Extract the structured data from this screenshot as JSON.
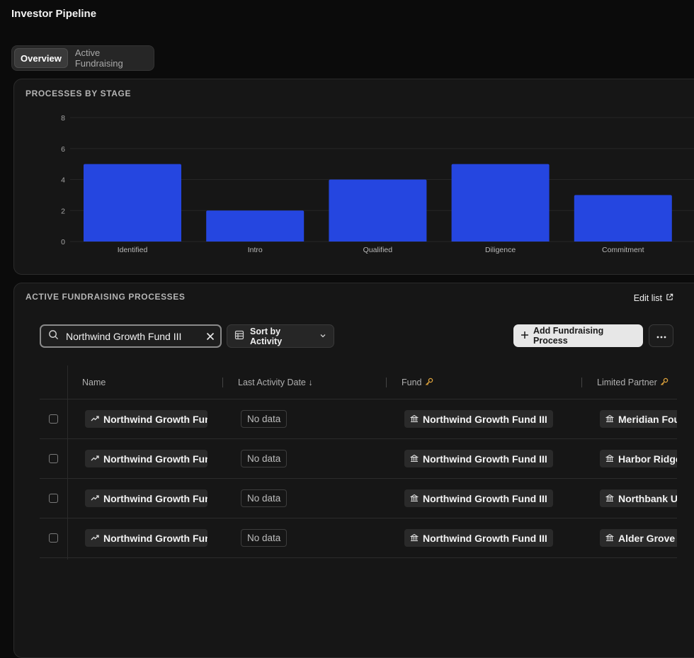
{
  "page": {
    "title": "Investor Pipeline"
  },
  "tabs": [
    {
      "label": "Overview",
      "active": true
    },
    {
      "label": "Active Fundraising",
      "active": false
    }
  ],
  "chart_section": {
    "title": "PROCESSES BY STAGE"
  },
  "chart_data": {
    "type": "bar",
    "title": "",
    "xlabel": "",
    "ylabel": "",
    "categories": [
      "Identified",
      "Intro",
      "Qualified",
      "Diligence",
      "Commitment"
    ],
    "values": [
      5,
      2,
      4,
      5,
      3
    ],
    "ylim": [
      0,
      8
    ],
    "yticks": [
      0,
      2,
      4,
      6,
      8
    ],
    "grid": true,
    "bar_color": "#2546e0"
  },
  "table_section": {
    "title": "ACTIVE FUNDRAISING PROCESSES",
    "edit_list_label": "Edit list",
    "search": {
      "value": "Northwind Growth Fund III",
      "icon": "search-icon"
    },
    "sort_label": "Sort by Activity",
    "add_label": "Add Fundraising Process",
    "columns": [
      {
        "label": "Name"
      },
      {
        "label": "Last Activity Date ↓"
      },
      {
        "label": "Fund"
      },
      {
        "label": "Limited Partner"
      }
    ],
    "rows": [
      {
        "name": "Northwind Growth Fund III",
        "last_activity": "No data",
        "fund": "Northwind Growth Fund III",
        "limited_partner": "Meridian Foundation"
      },
      {
        "name": "Northwind Growth Fund III",
        "last_activity": "No data",
        "fund": "Northwind Growth Fund III",
        "limited_partner": "Harbor Ridge"
      },
      {
        "name": "Northwind Growth Fund III",
        "last_activity": "No data",
        "fund": "Northwind Growth Fund III",
        "limited_partner": "Northbank U"
      },
      {
        "name": "Northwind Growth Fund III",
        "last_activity": "No data",
        "fund": "Northwind Growth Fund III",
        "limited_partner": "Alder Grove"
      }
    ]
  },
  "colors": {
    "accent": "#2546e0",
    "key_icon": "#e0a43c"
  }
}
